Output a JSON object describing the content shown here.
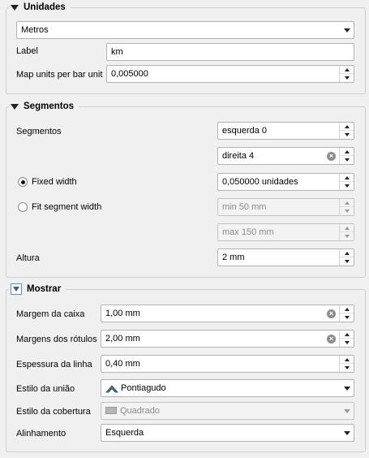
{
  "unidades": {
    "title": "Unidades",
    "units_value": "Metros",
    "label_label": "Label",
    "label_value": "km",
    "map_units_label": "Map units per bar unit",
    "map_units_value": "0,005000"
  },
  "segmentos": {
    "title": "Segmentos",
    "segmentos_label": "Segmentos",
    "left_value": "esquerda 0",
    "right_value": "direita 4",
    "fixed_width_label": "Fixed width",
    "fixed_width_value": "0,050000 unidades",
    "fit_width_label": "Fit segment width",
    "min_value": "min 50 mm",
    "max_value": "max 150 mm",
    "altura_label": "Altura",
    "altura_value": "2 mm"
  },
  "mostrar": {
    "title": "Mostrar",
    "margem_caixa_label": "Margem da caixa",
    "margem_caixa_value": "1,00 mm",
    "margens_rotulos_label": "Margens dos rótulos",
    "margens_rotulos_value": "2,00 mm",
    "espessura_label": "Espessura da linha",
    "espessura_value": "0,40 mm",
    "estilo_uniao_label": "Estilo da união",
    "estilo_uniao_value": "Pontiagudo",
    "estilo_cobertura_label": "Estilo da cobertura",
    "estilo_cobertura_value": "Quadrado",
    "alinhamento_label": "Alinhamento",
    "alinhamento_value": "Esquerda"
  }
}
